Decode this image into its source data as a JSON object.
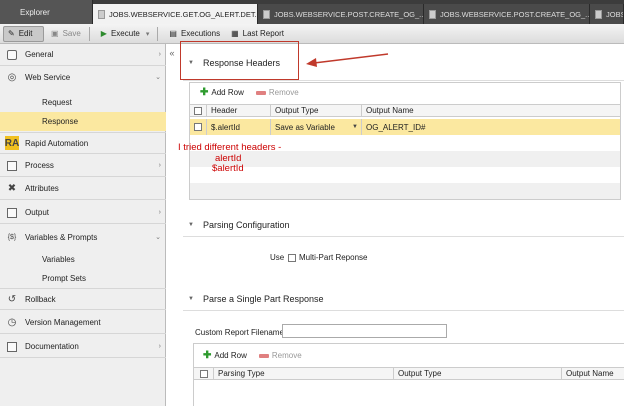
{
  "tabs": [
    {
      "label": "Explorer"
    },
    {
      "label": "JOBS.WEBSERVICE.GET.OG_ALERT.DET..."
    },
    {
      "label": "JOBS.WEBSERVICE.POST.CREATE_OG_..."
    },
    {
      "label": "JOBS.WEBSERVICE.POST.CREATE_OG_..."
    },
    {
      "label": "JOBS.W"
    }
  ],
  "toolbar": {
    "edit_label": "Edit",
    "save_label": "Save",
    "execute_label": "Execute",
    "executions_label": "Executions",
    "last_report_label": "Last Report"
  },
  "sidebar": {
    "items": [
      {
        "label": "General",
        "icon": "info-icon"
      },
      {
        "label": "Web Service",
        "icon": "globe-icon"
      },
      {
        "label": "Request"
      },
      {
        "label": "Response"
      },
      {
        "label": "Rapid Automation",
        "icon": "ra-icon",
        "badge": "RA"
      },
      {
        "label": "Process",
        "icon": "process-icon"
      },
      {
        "label": "Attributes",
        "icon": "tools-icon"
      },
      {
        "label": "Output",
        "icon": "output-icon"
      },
      {
        "label": "Variables & Prompts",
        "icon": "variables-icon",
        "badge": "{$}"
      },
      {
        "label": "Variables"
      },
      {
        "label": "Prompt Sets"
      },
      {
        "label": "Rollback",
        "icon": "rollback-icon"
      },
      {
        "label": "Version Management",
        "icon": "version-icon"
      },
      {
        "label": "Documentation",
        "icon": "documentation-icon"
      }
    ]
  },
  "response_headers": {
    "title": "Response Headers",
    "add_row": "Add Row",
    "remove": "Remove",
    "columns": [
      "Header",
      "Output Type",
      "Output Name"
    ],
    "rows": [
      {
        "header": "$.alertId",
        "output_type": "Save as Variable",
        "output_name": "OG_ALERT_ID#"
      }
    ]
  },
  "annotation": {
    "line1": "I tried different headers -",
    "line2": "alertId",
    "line3": "$alertId"
  },
  "parsing_configuration": {
    "title": "Parsing Configuration",
    "use_label": "Use",
    "multipart_label": "Multi-Part Reponse"
  },
  "single_part": {
    "title": "Parse a Single Part Response",
    "custom_report_label": "Custom Report Filename",
    "custom_report_value": "",
    "add_row": "Add Row",
    "remove": "Remove",
    "columns": [
      "Parsing Type",
      "Output Type",
      "Output Name"
    ]
  },
  "colors": {
    "highlight": "#fbe8a0",
    "annotation": "#c00000",
    "callout_box": "#c0392b"
  }
}
